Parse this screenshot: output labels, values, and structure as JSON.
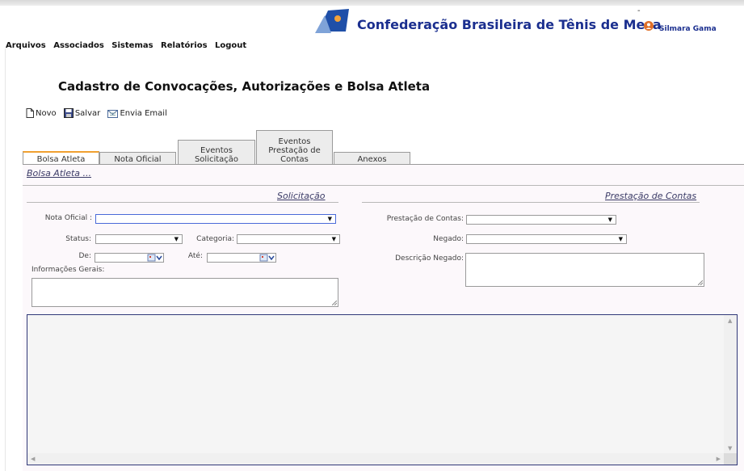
{
  "header": {
    "brand": "Confederação Brasileira de Tênis de Mesa",
    "dash": "-",
    "user_name": "Silmara Gama",
    "colors": {
      "brand": "#1b2f8f",
      "user_icon": "#e0702a",
      "logo_blue": "#1f4fa8"
    }
  },
  "menu": [
    "Arquivos",
    "Associados",
    "Sistemas",
    "Relatórios",
    "Logout"
  ],
  "page_title": "Cadastro de Convocações, Autorizações e Bolsa Atleta",
  "toolbar": {
    "new_label": "Novo",
    "save_label": "Salvar",
    "email_label": "Envia Email"
  },
  "tabs": [
    {
      "label": "Bolsa Atleta",
      "active": true
    },
    {
      "label": "Nota Oficial",
      "active": false
    },
    {
      "label": "Eventos Solicitação",
      "active": false
    },
    {
      "label": "Eventos Prestação de Contas",
      "active": false
    },
    {
      "label": "Anexos",
      "active": false
    }
  ],
  "breadcrumb_link": "Bolsa Atleta ...",
  "solicitacao": {
    "title": "Solicitação",
    "nota_oficial_label": "Nota Oficial :",
    "nota_oficial_value": "",
    "status_label": "Status:",
    "status_value": "",
    "categoria_label": "Categoria:",
    "categoria_value": "",
    "de_label": "De:",
    "de_value": "",
    "ate_label": "Até:",
    "ate_value": "",
    "info_label": "Informações Gerais:",
    "info_value": ""
  },
  "prestacao": {
    "title": "Prestação de Contas",
    "prestacao_label": "Prestação de Contas:",
    "prestacao_value": "",
    "negado_label": "Negado:",
    "negado_value": "",
    "descricao_label": "Descrição Negado:",
    "descricao_value": ""
  },
  "icons": [
    "logo-icon",
    "user-icon",
    "new-document-icon",
    "save-icon",
    "email-icon",
    "calendar-icon",
    "chevron-down-icon"
  ]
}
